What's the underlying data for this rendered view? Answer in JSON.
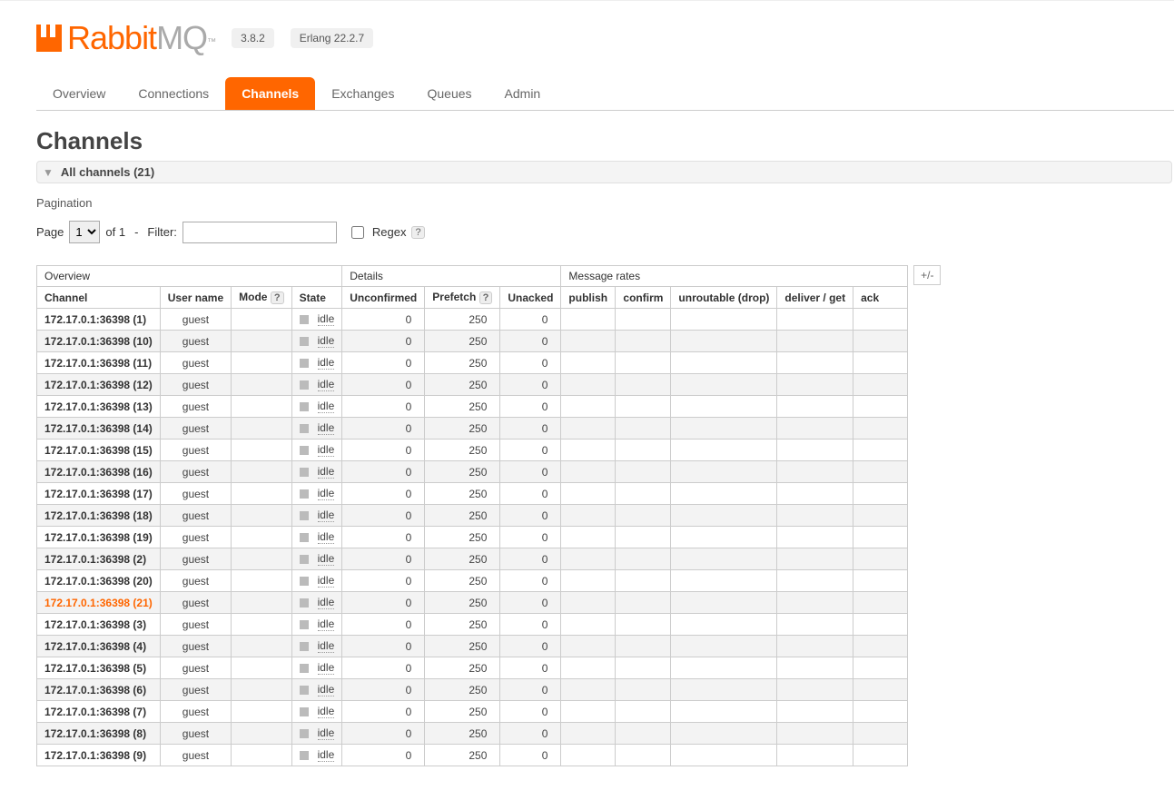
{
  "brand": {
    "rabbit": "Rabbit",
    "mq": "MQ",
    "tm": "™"
  },
  "versions": {
    "app": "3.8.2",
    "erlang": "Erlang 22.2.7"
  },
  "tabs": [
    {
      "label": "Overview",
      "active": false
    },
    {
      "label": "Connections",
      "active": false
    },
    {
      "label": "Channels",
      "active": true
    },
    {
      "label": "Exchanges",
      "active": false
    },
    {
      "label": "Queues",
      "active": false
    },
    {
      "label": "Admin",
      "active": false
    }
  ],
  "page_title": "Channels",
  "section_toggle": "All channels (21)",
  "pagination": {
    "label": "Pagination",
    "page_word": "Page",
    "page_select": "1",
    "of": "of 1",
    "dash": "-",
    "filter_label": "Filter:",
    "filter_value": "",
    "regex_label": "Regex",
    "help": "?"
  },
  "table": {
    "group_headers": [
      "Overview",
      "Details",
      "Message rates"
    ],
    "group_spans": [
      4,
      3,
      5
    ],
    "columns": [
      "Channel",
      "User name",
      "Mode",
      "State",
      "Unconfirmed",
      "Prefetch",
      "Unacked",
      "publish",
      "confirm",
      "unroutable (drop)",
      "deliver / get",
      "ack"
    ],
    "help": "?",
    "plusminus": "+/-",
    "rows": [
      {
        "channel": "172.17.0.1:36398 (1)",
        "user": "guest",
        "state": "idle",
        "unconfirmed": "0",
        "prefetch": "250",
        "unacked": "0",
        "hl": false
      },
      {
        "channel": "172.17.0.1:36398 (10)",
        "user": "guest",
        "state": "idle",
        "unconfirmed": "0",
        "prefetch": "250",
        "unacked": "0",
        "hl": false
      },
      {
        "channel": "172.17.0.1:36398 (11)",
        "user": "guest",
        "state": "idle",
        "unconfirmed": "0",
        "prefetch": "250",
        "unacked": "0",
        "hl": false
      },
      {
        "channel": "172.17.0.1:36398 (12)",
        "user": "guest",
        "state": "idle",
        "unconfirmed": "0",
        "prefetch": "250",
        "unacked": "0",
        "hl": false
      },
      {
        "channel": "172.17.0.1:36398 (13)",
        "user": "guest",
        "state": "idle",
        "unconfirmed": "0",
        "prefetch": "250",
        "unacked": "0",
        "hl": false
      },
      {
        "channel": "172.17.0.1:36398 (14)",
        "user": "guest",
        "state": "idle",
        "unconfirmed": "0",
        "prefetch": "250",
        "unacked": "0",
        "hl": false
      },
      {
        "channel": "172.17.0.1:36398 (15)",
        "user": "guest",
        "state": "idle",
        "unconfirmed": "0",
        "prefetch": "250",
        "unacked": "0",
        "hl": false
      },
      {
        "channel": "172.17.0.1:36398 (16)",
        "user": "guest",
        "state": "idle",
        "unconfirmed": "0",
        "prefetch": "250",
        "unacked": "0",
        "hl": false
      },
      {
        "channel": "172.17.0.1:36398 (17)",
        "user": "guest",
        "state": "idle",
        "unconfirmed": "0",
        "prefetch": "250",
        "unacked": "0",
        "hl": false
      },
      {
        "channel": "172.17.0.1:36398 (18)",
        "user": "guest",
        "state": "idle",
        "unconfirmed": "0",
        "prefetch": "250",
        "unacked": "0",
        "hl": false
      },
      {
        "channel": "172.17.0.1:36398 (19)",
        "user": "guest",
        "state": "idle",
        "unconfirmed": "0",
        "prefetch": "250",
        "unacked": "0",
        "hl": false
      },
      {
        "channel": "172.17.0.1:36398 (2)",
        "user": "guest",
        "state": "idle",
        "unconfirmed": "0",
        "prefetch": "250",
        "unacked": "0",
        "hl": false
      },
      {
        "channel": "172.17.0.1:36398 (20)",
        "user": "guest",
        "state": "idle",
        "unconfirmed": "0",
        "prefetch": "250",
        "unacked": "0",
        "hl": false
      },
      {
        "channel": "172.17.0.1:36398 (21)",
        "user": "guest",
        "state": "idle",
        "unconfirmed": "0",
        "prefetch": "250",
        "unacked": "0",
        "hl": true
      },
      {
        "channel": "172.17.0.1:36398 (3)",
        "user": "guest",
        "state": "idle",
        "unconfirmed": "0",
        "prefetch": "250",
        "unacked": "0",
        "hl": false
      },
      {
        "channel": "172.17.0.1:36398 (4)",
        "user": "guest",
        "state": "idle",
        "unconfirmed": "0",
        "prefetch": "250",
        "unacked": "0",
        "hl": false
      },
      {
        "channel": "172.17.0.1:36398 (5)",
        "user": "guest",
        "state": "idle",
        "unconfirmed": "0",
        "prefetch": "250",
        "unacked": "0",
        "hl": false
      },
      {
        "channel": "172.17.0.1:36398 (6)",
        "user": "guest",
        "state": "idle",
        "unconfirmed": "0",
        "prefetch": "250",
        "unacked": "0",
        "hl": false
      },
      {
        "channel": "172.17.0.1:36398 (7)",
        "user": "guest",
        "state": "idle",
        "unconfirmed": "0",
        "prefetch": "250",
        "unacked": "0",
        "hl": false
      },
      {
        "channel": "172.17.0.1:36398 (8)",
        "user": "guest",
        "state": "idle",
        "unconfirmed": "0",
        "prefetch": "250",
        "unacked": "0",
        "hl": false
      },
      {
        "channel": "172.17.0.1:36398 (9)",
        "user": "guest",
        "state": "idle",
        "unconfirmed": "0",
        "prefetch": "250",
        "unacked": "0",
        "hl": false
      }
    ]
  }
}
